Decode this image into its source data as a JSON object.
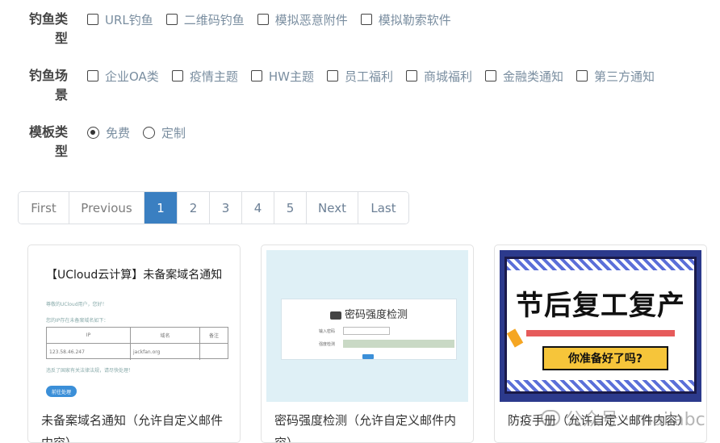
{
  "filters": {
    "phish_type": {
      "label_line1": "钓鱼类",
      "label_line2": "型",
      "options": [
        "URL钓鱼",
        "二维码钓鱼",
        "模拟恶意附件",
        "模拟勒索软件"
      ]
    },
    "phish_scene": {
      "label_line1": "钓鱼场",
      "label_line2": "景",
      "options": [
        "企业OA类",
        "疫情主题",
        "HW主题",
        "员工福利",
        "商城福利",
        "金融类通知",
        "第三方通知"
      ]
    },
    "template_type": {
      "label_line1": "模板类",
      "label_line2": "型",
      "options": [
        "免费",
        "定制"
      ],
      "selected": "免费"
    }
  },
  "pagination": {
    "first": "First",
    "previous": "Previous",
    "pages": [
      "1",
      "2",
      "3",
      "4",
      "5"
    ],
    "current": "1",
    "next": "Next",
    "last": "Last"
  },
  "cards": [
    {
      "title": "未备案域名通知（允许自定义邮件内容）",
      "thumb": {
        "heading": "【UCloud云计算】未备案域名通知",
        "line1": "尊敬的UCloud用户，您好！",
        "line2": "您的IP存在未备案域名如下：",
        "table_headers": [
          "IP",
          "域名",
          "备注"
        ],
        "table_row": [
          "123.58.46.247",
          "jackfan.org",
          ""
        ],
        "line3": "违反了国家有关法律法规，请尽快处理！",
        "button": "前往处理"
      }
    },
    {
      "title": "密码强度检测（允许自定义邮件内容）",
      "thumb": {
        "heading": "密码强度检测",
        "label1": "输入密码",
        "label2": "强度检测"
      }
    },
    {
      "title": "防疫手册（允许自定义邮件内容）",
      "thumb": {
        "heading": "节后复工复产",
        "banner": "你准备好了吗?"
      }
    }
  ],
  "watermark": "公众号 · mailabc",
  "colors": {
    "accent": "#3a7fc1",
    "option_text": "#7a8ea0",
    "label_text": "#444444"
  }
}
